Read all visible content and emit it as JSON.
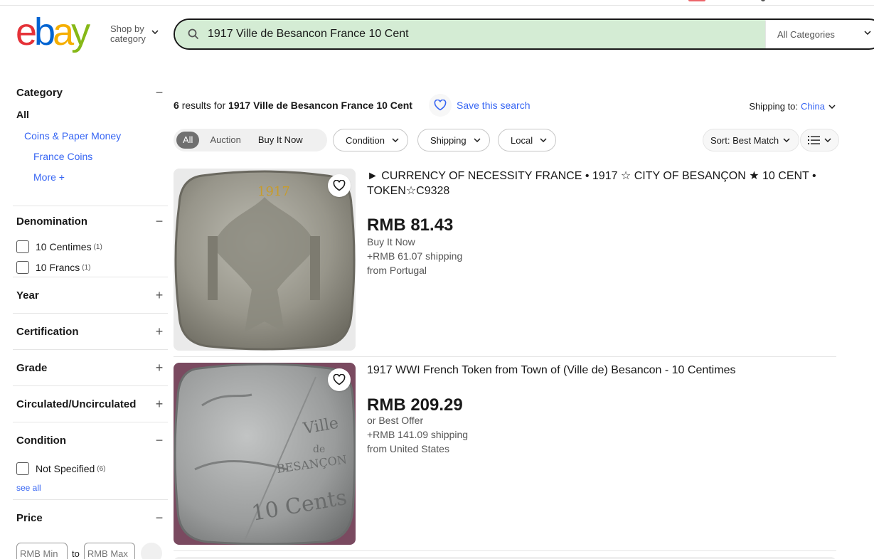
{
  "header": {
    "logo_letters": [
      "e",
      "b",
      "a",
      "y"
    ],
    "logo_colors": [
      "#e53238",
      "#0064d2",
      "#f5af02",
      "#86b817"
    ],
    "shop_by_line1": "Shop by",
    "shop_by_line2": "category",
    "search_value": "1917 Ville de Besancon France 10 Cent",
    "category_select": "All Categories"
  },
  "sidebar": {
    "category": {
      "title": "Category",
      "toggle": "−",
      "all": "All",
      "level1": "Coins & Paper Money",
      "level2": "France Coins",
      "more": "More +"
    },
    "denomination": {
      "title": "Denomination",
      "toggle": "−",
      "options": [
        {
          "label": "10 Centimes",
          "count": "(1)"
        },
        {
          "label": "10 Francs",
          "count": "(1)"
        }
      ]
    },
    "collapsed": [
      {
        "title": "Year",
        "toggle": "+"
      },
      {
        "title": "Certification",
        "toggle": "+"
      },
      {
        "title": "Grade",
        "toggle": "+"
      },
      {
        "title": "Circulated/Uncirculated",
        "toggle": "+"
      }
    ],
    "condition": {
      "title": "Condition",
      "toggle": "−",
      "options": [
        {
          "label": "Not Specified",
          "count": "(6)"
        }
      ],
      "see_all": "see all"
    },
    "price": {
      "title": "Price",
      "toggle": "−",
      "min_placeholder": "RMB Min",
      "to": "to",
      "max_placeholder": "RMB Max"
    }
  },
  "results": {
    "count": "6",
    "results_for": "results for",
    "query": "1917 Ville de Besancon France 10 Cent",
    "save_search": "Save this search",
    "shipping_to_label": "Shipping to:",
    "shipping_to_value": "China"
  },
  "filters": {
    "segments": [
      "All",
      "Auction",
      "Buy It Now"
    ],
    "pills": [
      "Condition",
      "Shipping",
      "Local"
    ],
    "sort": "Sort: Best Match"
  },
  "items": [
    {
      "title": "► CURRENCY OF NECESSITY FRANCE • 1917 ☆ CITY OF BESANÇON ★ 10 CENT • TOKEN☆C9328",
      "price": "RMB 81.43",
      "format": "Buy It Now",
      "shipping": "+RMB 61.07 shipping",
      "location": "from Portugal"
    },
    {
      "title": "1917 WWI French Token from Town of (Ville de) Besancon - 10 Centimes",
      "price": "RMB 209.29",
      "format": "or Best Offer",
      "shipping": "+RMB 141.09 shipping",
      "location": "from United States"
    }
  ],
  "item_images": [
    {
      "text_top": "1917"
    },
    {
      "text_lines": [
        "Ville",
        "de",
        "BESANÇON",
        "10 Cents"
      ]
    }
  ],
  "colors": {
    "link": "#3665f3",
    "search_bg": "#d4ecd4",
    "text": "#191919"
  }
}
